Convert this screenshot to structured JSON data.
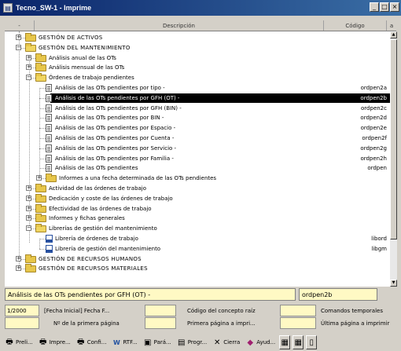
{
  "window": {
    "title": "Tecno_SW-1 - Imprime",
    "buttons": [
      "_",
      "□",
      "×"
    ]
  },
  "columns": {
    "selector": "-",
    "description": "Descripción",
    "code": "Código",
    "extra": "a"
  },
  "tree": {
    "items": [
      {
        "label": "GESTIÓN DE ACTIVOS",
        "code": "",
        "kind": "folder"
      },
      {
        "label": "GESTIÓN DEL MANTENIMIENTO",
        "code": "",
        "kind": "folder-open"
      },
      {
        "label": "Análisis anual de las OTs",
        "code": "",
        "kind": "folder"
      },
      {
        "label": "Análisis mensual de las OTs",
        "code": "",
        "kind": "folder"
      },
      {
        "label": "Órdenes de trabajo pendientes",
        "code": "",
        "kind": "folder-open"
      },
      {
        "label": "Análisis de las OTs pendientes por tipo -",
        "code": "ordpen2a",
        "kind": "doc"
      },
      {
        "label": "Análisis de las OTs pendientes por GFH (OT) -",
        "code": "ordpen2b",
        "kind": "doc"
      },
      {
        "label": "Análisis de las OTs pendientes por GFH (BIN) -",
        "code": "ordpen2c",
        "kind": "doc"
      },
      {
        "label": "Análisis de las OTs pendientes por BIN -",
        "code": "ordpen2d",
        "kind": "doc"
      },
      {
        "label": "Análisis de las OTs pendientes por Espacio -",
        "code": "ordpen2e",
        "kind": "doc"
      },
      {
        "label": "Análisis de las OTs pendientes por Cuenta -",
        "code": "ordpen2f",
        "kind": "doc"
      },
      {
        "label": "Análisis de las OTs pendientes por Servicio -",
        "code": "ordpen2g",
        "kind": "doc"
      },
      {
        "label": "Análisis de las OTs pendientes por Familia -",
        "code": "ordpen2h",
        "kind": "doc"
      },
      {
        "label": "Análisis de las OTs pendientes",
        "code": "ordpen",
        "kind": "doc"
      },
      {
        "label": "Informes a una fecha determinada de las OTs pendientes",
        "code": "",
        "kind": "folder"
      },
      {
        "label": "Actividad de las órdenes de trabajo",
        "code": "",
        "kind": "folder"
      },
      {
        "label": "Dedicación y coste de las órdenes de trabajo",
        "code": "",
        "kind": "folder"
      },
      {
        "label": "Efectividad de las órdenes de trabajo",
        "code": "",
        "kind": "folder"
      },
      {
        "label": "Informes y fichas generales",
        "code": "",
        "kind": "folder"
      },
      {
        "label": "Librerías de gestión del mantenimiento",
        "code": "",
        "kind": "folder-open"
      },
      {
        "label": "Librería de órdenes de trabajo",
        "code": "libord",
        "kind": "book"
      },
      {
        "label": "Librería de gestión del mantenimiento",
        "code": "libgm",
        "kind": "book"
      },
      {
        "label": "GESTIÓN DE RECURSOS HUMANOS",
        "code": "",
        "kind": "folder"
      },
      {
        "label": "GESTIÓN DE RECURSOS MATERIALES",
        "code": "",
        "kind": "folder"
      }
    ],
    "selected_index": 6
  },
  "selection": {
    "description": "Análisis de las OTs pendientes por GFH (OT) -",
    "code": "ordpen2b"
  },
  "params": {
    "counter": "1/2000",
    "fecha_inicial": "[Fecha Inicial] Fecha F...",
    "codigo_concepto": "Código del concepto raíz",
    "comandos_temporales": "Comandos temporales",
    "primera_pagina": "Nº de la primera página",
    "primera_pagina_imprimir": "Primera página a impri...",
    "ultima_pagina": "Última página a imprimir"
  },
  "toolbar": {
    "preview": "Preli...",
    "print": "Impre...",
    "config": "Confi...",
    "rtf": "RTF...",
    "params": "Pará...",
    "progress": "Progr...",
    "close": "Cierra",
    "help": "Ayud..."
  },
  "colors": {
    "title_bar": "#0a246a",
    "selected_row": "#000000",
    "field_bg": "#fff9c4",
    "folder": "#e7c64a"
  }
}
